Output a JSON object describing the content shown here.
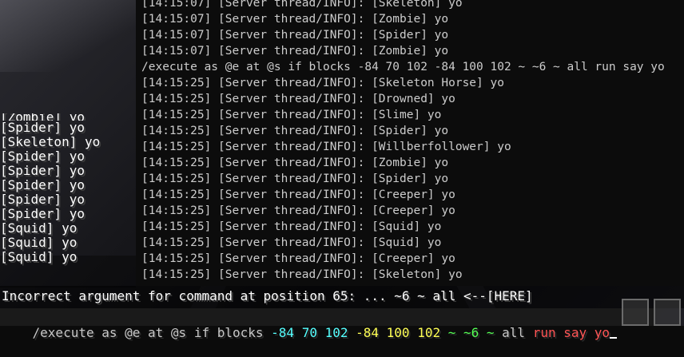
{
  "console": {
    "lines": [
      "[14:15:07] [Server thread/INFO]: [Skeleton] yo",
      "[14:15:07] [Server thread/INFO]: [Zombie] yo",
      "[14:15:07] [Server thread/INFO]: [Spider] yo",
      "[14:15:07] [Server thread/INFO]: [Zombie] yo",
      "/execute as @e at @s if blocks -84 70 102 -84 100 102 ~ ~6 ~ all run say yo",
      "[14:15:25] [Server thread/INFO]: [Skeleton Horse] yo",
      "[14:15:25] [Server thread/INFO]: [Drowned] yo",
      "[14:15:25] [Server thread/INFO]: [Slime] yo",
      "[14:15:25] [Server thread/INFO]: [Spider] yo",
      "[14:15:25] [Server thread/INFO]: [Willberfollower] yo",
      "[14:15:25] [Server thread/INFO]: [Zombie] yo",
      "[14:15:25] [Server thread/INFO]: [Spider] yo",
      "[14:15:25] [Server thread/INFO]: [Creeper] yo",
      "[14:15:25] [Server thread/INFO]: [Creeper] yo",
      "[14:15:25] [Server thread/INFO]: [Squid] yo",
      "[14:15:25] [Server thread/INFO]: [Squid] yo",
      "[14:15:25] [Server thread/INFO]: [Creeper] yo",
      "[14:15:25] [Server thread/INFO]: [Skeleton] yo"
    ]
  },
  "chat": {
    "messages": [
      "[Zombie] yo",
      "[Spider] yo",
      "[Skeleton] yo",
      "[Spider] yo",
      "[Spider] yo",
      "[Spider] yo",
      "[Spider] yo",
      "[Spider] yo",
      "[Squid] yo",
      "[Squid] yo",
      "[Squid] yo"
    ]
  },
  "error": {
    "text": "Incorrect argument for command at position 65: ... ~6 ~ all <--[HERE]"
  },
  "command_input": {
    "tokens": [
      {
        "text": "/execute as @e at @s if blocks ",
        "color": "#c8c8c8"
      },
      {
        "text": "-84 70 102 ",
        "color": "#55ffff"
      },
      {
        "text": "-84 100 102 ",
        "color": "#ffff55"
      },
      {
        "text": "~ ~6 ~ ",
        "color": "#55ff55"
      },
      {
        "text": "all ",
        "color": "#c8c8c8"
      },
      {
        "text": "run say yo",
        "color": "#ff5555"
      }
    ]
  },
  "colors": {
    "console_text": "#cccccc",
    "chat_text": "#ffffff",
    "error_text": "#ffffff"
  }
}
